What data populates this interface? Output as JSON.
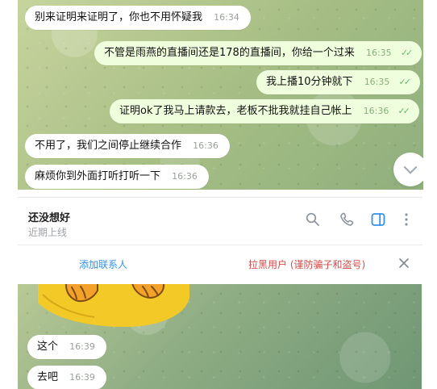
{
  "top_chat": {
    "messages": [
      {
        "text": "别来证明来证明了，你也不用怀疑我",
        "time": "16:34"
      },
      {
        "text": "不管是雨燕的直播间还是178的直播间，你给一个过来",
        "time": "16:35",
        "ticks": "✓✓"
      },
      {
        "text": "我上播10分钟就下",
        "time": "16:35",
        "ticks": "✓✓"
      },
      {
        "text": "证明ok了我马上请款去，老板不批我就挂自己帐上",
        "time": "16:36",
        "ticks": "✓✓"
      },
      {
        "text": "不用了，我们之间停止继续合作",
        "time": "16:36"
      },
      {
        "text": "麻烦你到外面打听打听一下",
        "time": "16:36"
      }
    ]
  },
  "header": {
    "title": "还没想好",
    "status": "近期上线"
  },
  "action_bar": {
    "add_contact": "添加联系人",
    "block_user": "拉黑用户 (谨防骗子和盗号)"
  },
  "bottom_chat": {
    "messages": [
      {
        "text": "这个",
        "time": "16:39"
      },
      {
        "text": "去吧",
        "time": "16:39"
      }
    ]
  },
  "icons": {
    "search": "search-icon",
    "call": "phone-icon",
    "sidebar": "sidebar-icon",
    "more": "more-icon",
    "close": "close-icon",
    "scroll_down": "chevron-down-icon"
  },
  "colors": {
    "accent_blue": "#3390ec",
    "danger_red": "#d14b4b",
    "outgoing_bubble": "#efffde",
    "incoming_bubble": "#ffffff",
    "read_tick": "#63b86b"
  }
}
